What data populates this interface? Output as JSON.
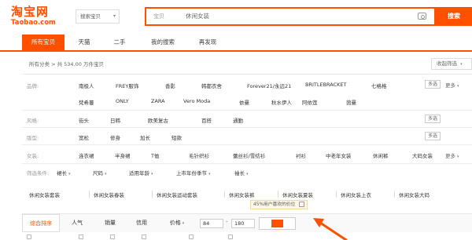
{
  "header": {
    "logo_cn": "淘宝网",
    "logo_en": "Taobao.com",
    "scope_label": "搜索宝贝",
    "search_tag": "宝贝",
    "search_query": "休闲女装",
    "search_button": "搜索"
  },
  "tabs": [
    "所有宝贝",
    "天猫",
    "二手",
    "我的搜索",
    "再发现"
  ],
  "summary": {
    "text": "所有分类 > 共 534.00 万件宝贝",
    "collapse_label": "收起筛选"
  },
  "filters": {
    "brand": {
      "label": "品牌:",
      "items": [
        "南极人",
        "FREY服饰",
        "香影",
        "韩都衣舍",
        "Forever21/永远21",
        "BRITLEBRACKET",
        "七格格",
        "梵希蔓",
        "ONLY",
        "ZARA",
        "Vero Moda",
        "依曼",
        "秋水伊人",
        "阿依莲",
        "茵曼"
      ],
      "multi_label": "多选",
      "more_label": "更多"
    },
    "style": {
      "label": "风格:",
      "items": [
        "街头",
        "日韩",
        "欧美复古",
        "百搭",
        "通勤"
      ],
      "multi_label": "多选"
    },
    "fit": {
      "label": "版型:",
      "items": [
        "宽松",
        "修身",
        "加长",
        "短款"
      ],
      "multi_label": "多选"
    },
    "category": {
      "label": "女装:",
      "items": [
        "连衣裙",
        "半身裙",
        "T恤",
        "毛针织衫",
        "蕾丝衫/雪纺衫",
        "衬衫",
        "中老年女装",
        "休闲裤",
        "大码女装"
      ],
      "more_label": "更多"
    },
    "filters_row": {
      "label": "筛选条件:",
      "items": [
        "裙长",
        "尺码",
        "适用年龄",
        "上市年份季节",
        "袖长"
      ]
    }
  },
  "hot_terms": [
    "休闲女装套装",
    "休闲女装春装",
    "休闲女装运动套装",
    "休闲女装裤",
    "休闲女装夏装",
    "休闲女装上衣",
    "休闲女装大码"
  ],
  "sort": {
    "items": [
      "综合排序",
      "人气",
      "销量",
      "信用",
      "价格"
    ],
    "price_min": "84",
    "price_max": "180",
    "price_range_percent": 45
  },
  "tooltip": "45%用户喜欢的价位",
  "colors": {
    "accent": "#ff5000"
  }
}
